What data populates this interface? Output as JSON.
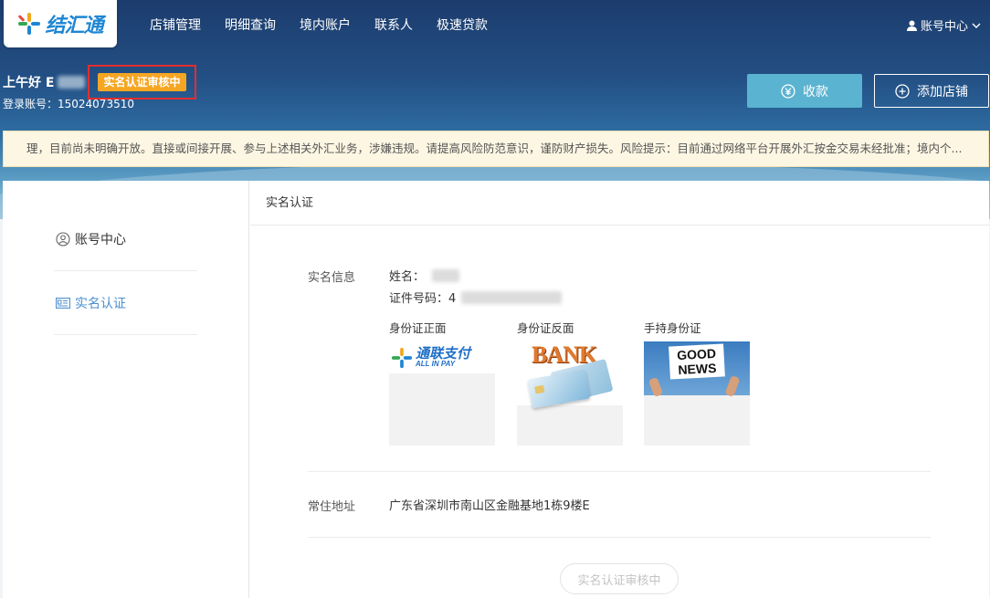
{
  "header": {
    "logo_text": "结汇通",
    "nav": [
      "店铺管理",
      "明细查询",
      "境内账户",
      "联系人",
      "极速贷款"
    ],
    "account_center": "账号中心"
  },
  "user": {
    "greeting": "上午好 E",
    "status_badge": "实名认证审核中",
    "login_account": "登录账号：15024073510"
  },
  "actions": {
    "collect": "收款",
    "add_shop": "添加店铺"
  },
  "notice": "理，目前尚未明确开放。直接或间接开展、参与上述相关外汇业务，涉嫌违规。请提高风险防范意识，谨防财产损失。风险提示：目前通过网络平台开展外汇按金交易未经批准；境内个...",
  "sidebar": {
    "items": [
      {
        "label": "账号中心",
        "icon": "user-circle-icon"
      },
      {
        "label": "实名认证",
        "icon": "id-card-icon",
        "active": true
      }
    ]
  },
  "main": {
    "title": "实名认证",
    "info_label": "实名信息",
    "name_label": "姓名：",
    "id_label": "证件号码：4",
    "photos": [
      {
        "label": "身份证正面"
      },
      {
        "label": "身份证反面",
        "caption": "BANK"
      },
      {
        "label": "手持身份证",
        "caption_line1": "GOOD",
        "caption_line2": "NEWS"
      }
    ],
    "photo1_brand_cn": "通联支付",
    "photo1_brand_en": "ALL IN PAY",
    "address_label": "常住地址",
    "address_value": "广东省深圳市南山区金融基地1栋9楼E",
    "pending_button": "实名认证审核中"
  },
  "colors": {
    "accent": "#4b8fd0",
    "badge": "#f5a623",
    "highlight_border": "#e52d2d",
    "collect_button": "#5ab3d0"
  }
}
